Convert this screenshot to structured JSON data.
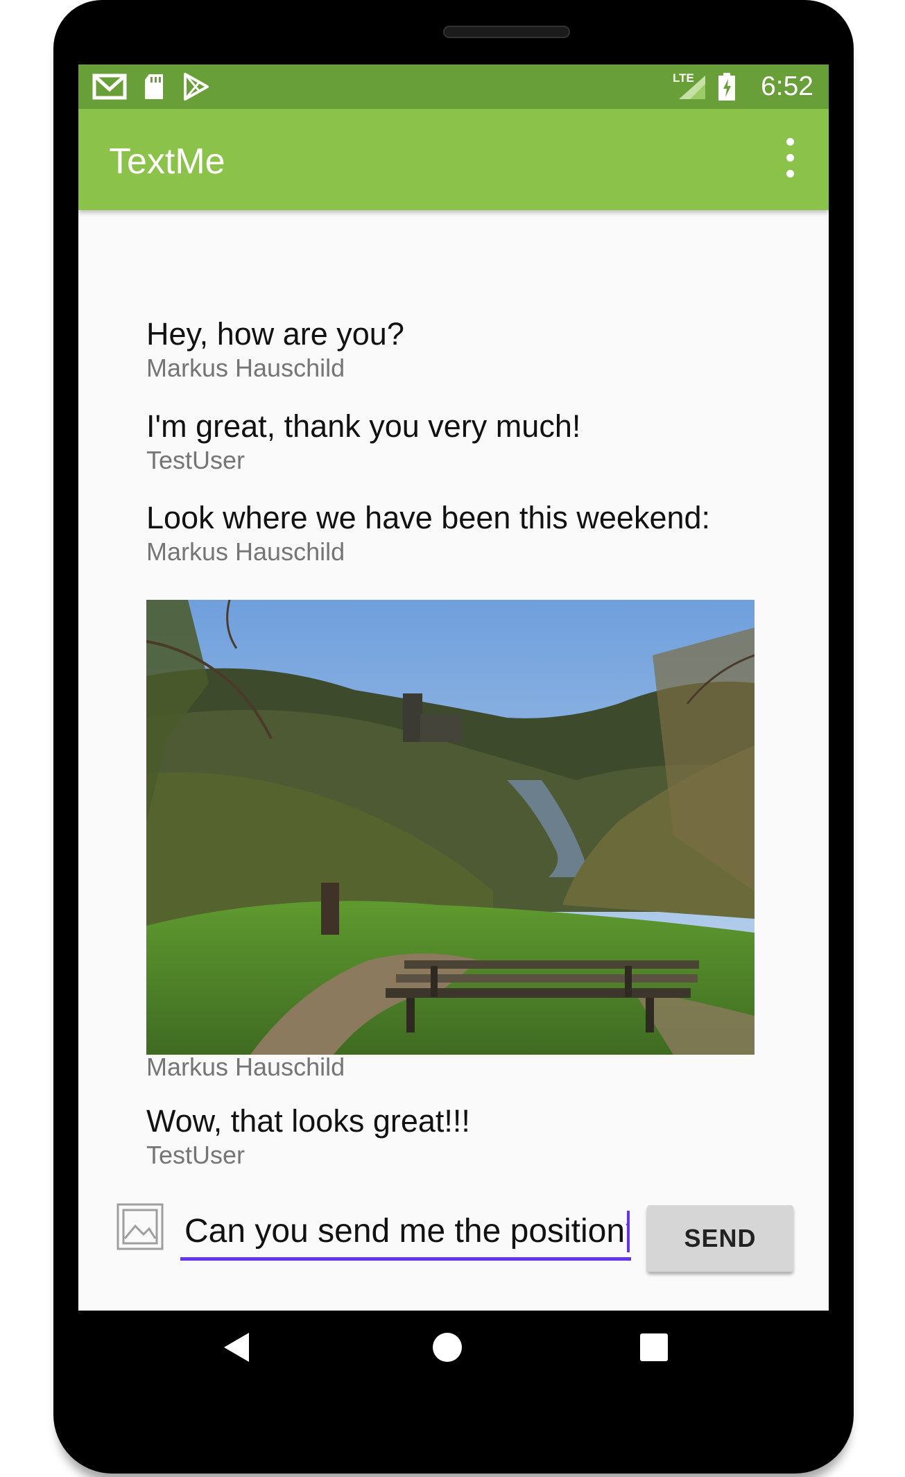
{
  "status_bar": {
    "time": "6:52",
    "network": "LTE",
    "icons": [
      "gmail-icon",
      "sd-card-icon",
      "play-store-icon",
      "signal-icon",
      "battery-charging-icon"
    ]
  },
  "app_bar": {
    "title": "TextMe",
    "menu_icon": "overflow-menu-icon"
  },
  "messages": [
    {
      "text": "Hey, how are you?",
      "sender": "Markus Hauschild"
    },
    {
      "text": "I'm great, thank you very much!",
      "sender": "TestUser"
    },
    {
      "text": "Look where we have been this weekend:",
      "sender": "Markus Hauschild"
    },
    {
      "image": "landscape-photo",
      "sender": "Markus Hauschild"
    },
    {
      "text": "Wow, that looks great!!!",
      "sender": "TestUser"
    }
  ],
  "compose": {
    "attach_icon": "image-icon",
    "value": "Can you send me the position?",
    "send_label": "SEND"
  },
  "nav_bar": {
    "icons": [
      "back-icon",
      "home-icon",
      "recents-icon"
    ]
  },
  "colors": {
    "status_bar": "#689f38",
    "app_bar": "#8bc34a",
    "input_underline": "#6633ee",
    "send_button": "#d6d6d6"
  }
}
